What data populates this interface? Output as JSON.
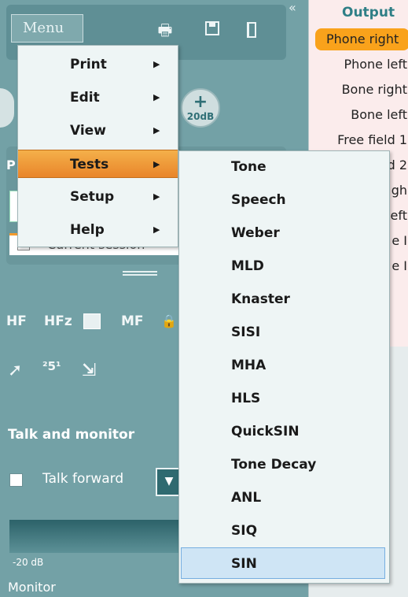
{
  "toolbar": {
    "menu_label": "Menu",
    "print_icon": "printer-icon",
    "save_icon": "floppy-disk-icon",
    "exit_icon": "door-exit-icon",
    "collapse_icon": "double-chevron-icon"
  },
  "db_step": {
    "plus": "+",
    "label": "20dB"
  },
  "session": {
    "panel_initial": "P",
    "current_session_label": "Current session"
  },
  "tools": {
    "hf": "HF",
    "hfz": "HFz",
    "mf": "MF",
    "num": "²5¹"
  },
  "talk_monitor": {
    "title": "Talk and monitor",
    "talk_forward_label": "Talk forward",
    "meter_label": "-20 dB",
    "monitor_label": "Monitor"
  },
  "output": {
    "title": "Output",
    "items": [
      "Phone right",
      "Phone left",
      "Bone right",
      "Bone left",
      "Free field 1",
      "d 2",
      "gh",
      "eft",
      "e I",
      "e I"
    ]
  },
  "main_menu": {
    "items": [
      {
        "label": "Print",
        "arrow": "▶"
      },
      {
        "label": "Edit",
        "arrow": "▶"
      },
      {
        "label": "View",
        "arrow": "▶"
      },
      {
        "label": "Tests",
        "arrow": "▶"
      },
      {
        "label": "Setup",
        "arrow": "▶"
      },
      {
        "label": "Help",
        "arrow": "▶"
      }
    ],
    "selected": "Tests"
  },
  "tests_menu": {
    "items": [
      "Tone",
      "Speech",
      "Weber",
      "MLD",
      "Knaster",
      "SISI",
      "MHA",
      "HLS",
      "QuickSIN",
      "Tone Decay",
      "ANL",
      "SIQ",
      "SIN"
    ],
    "hovered": "SIN"
  },
  "colors": {
    "panel_teal": "#73a1a6",
    "menu_highlight": "#e9852a",
    "output_selected": "#f9a21b",
    "hover_blue": "#cfe5f5"
  }
}
